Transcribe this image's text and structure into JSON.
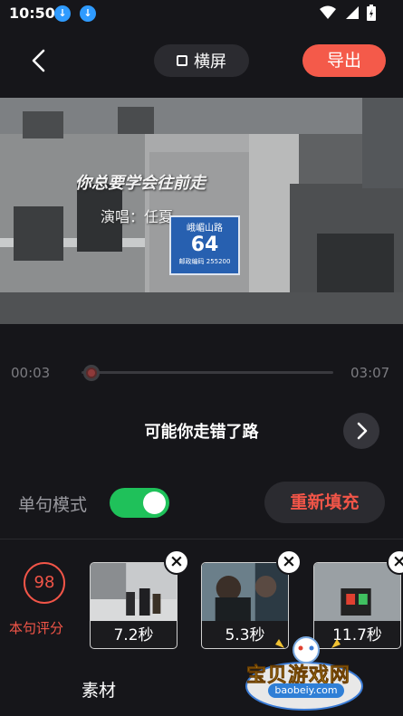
{
  "status_bar": {
    "time": "10:50",
    "download_icons": [
      "download-icon",
      "download-icon"
    ],
    "right_icons": [
      "wifi-icon",
      "signal-icon",
      "battery-icon"
    ]
  },
  "top_bar": {
    "orientation_label": "横屏",
    "export_label": "导出",
    "accent_color": "#f45a4a"
  },
  "video": {
    "lyric": "你总要学会往前走",
    "singer": "演唱：任夏",
    "sign": {
      "street": "峨嵋山路",
      "number": "64",
      "postcode": "邮政编码 255200"
    }
  },
  "timeline": {
    "current_time": "00:03",
    "total_time": "03:07",
    "progress_fraction": 0.016
  },
  "sentence": {
    "text": "可能你走错了路"
  },
  "mode": {
    "label": "单句模式",
    "toggle_on": true,
    "refill_label": "重新填充"
  },
  "score": {
    "value": "98",
    "label": "本句评分"
  },
  "clips": [
    {
      "duration": "7.2秒"
    },
    {
      "duration": "5.3秒"
    },
    {
      "duration": "11.7秒"
    }
  ],
  "bottom": {
    "material_label": "素材"
  },
  "watermark": {
    "title": "宝贝游戏网",
    "url": "baobeiy.com"
  }
}
